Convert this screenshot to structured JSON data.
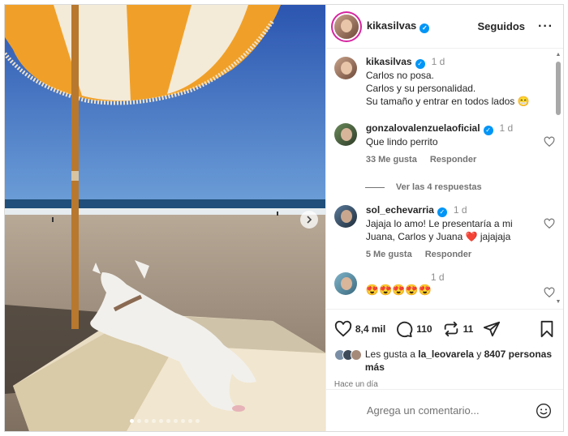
{
  "post": {
    "author": "kikasilvas",
    "follow_label": "Seguidos",
    "more_label": "···"
  },
  "caption": {
    "author": "kikasilvas",
    "time": "1 d",
    "lines": [
      "Carlos no posa.",
      "Carlos y su personalidad.",
      "Su tamaño y entrar en todos lados 😁"
    ]
  },
  "comments": [
    {
      "author": "gonzalovalenzuelaoficial",
      "time": "1 d",
      "text": "Que lindo perrito",
      "likes": "33 Me gusta",
      "reply": "Responder",
      "replies": "Ver las 4 respuestas"
    },
    {
      "author": "sol_echevarria",
      "time": "1 d",
      "text_before": "Jajaja lo amo! Le presentaría a mi Juana, Carlos y Juana ",
      "heart": "❤️",
      "text_after": " jajajaja",
      "likes": "5 Me gusta",
      "reply": "Responder"
    },
    {
      "author": "",
      "time": "1 d",
      "text": "😍😍😍😍😍"
    }
  ],
  "actions": {
    "likes_count": "8,4 mil",
    "comments_count": "110",
    "reposts_count": "11"
  },
  "liked_by": {
    "prefix": "Les gusta a ",
    "user": "la_leovarela",
    "middle": " y ",
    "others": "8407 personas más"
  },
  "posted_ago": "Hace un día",
  "composer": {
    "placeholder": "Agrega un comentario..."
  },
  "carousel": {
    "count": 10,
    "active": 0
  },
  "colors": {
    "verified": "#0095f6",
    "story_ring": "#d6249f",
    "heart": "#ed4956"
  }
}
